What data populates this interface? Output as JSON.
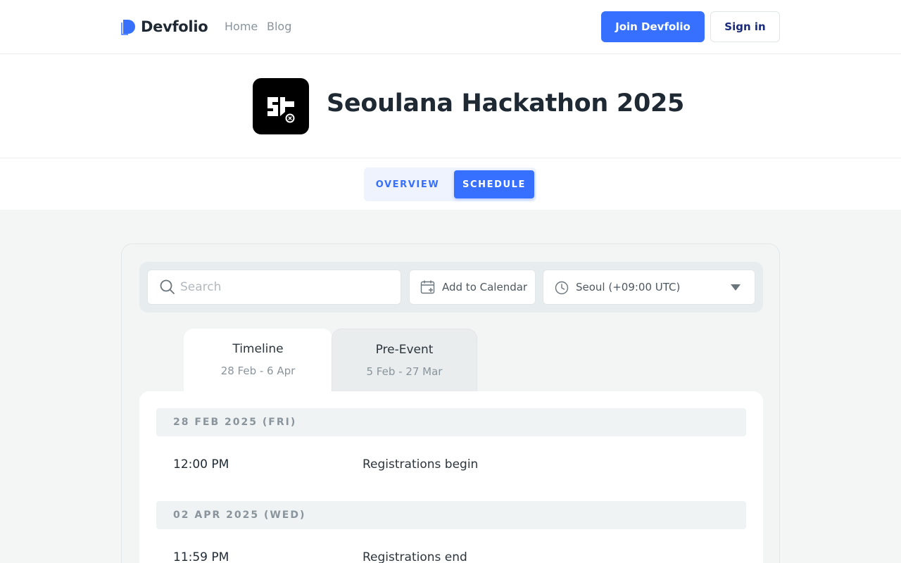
{
  "nav": {
    "brand": "Devfolio",
    "links": [
      "Home",
      "Blog"
    ],
    "join_label": "Join Devfolio",
    "signin_label": "Sign in"
  },
  "hero": {
    "title": "Seoulana Hackathon 2025",
    "logo_icon": "seoulana-logo"
  },
  "tabs": {
    "overview": "OVERVIEW",
    "schedule": "SCHEDULE",
    "active": "SCHEDULE"
  },
  "toolbar": {
    "search_placeholder": "Search",
    "search_value": "",
    "calendar_label": "Add to Calendar",
    "timezone": "Seoul (+09:00 UTC)"
  },
  "schedule_tabs": [
    {
      "title": "Timeline",
      "dates": "28 Feb - 6 Apr",
      "active": true
    },
    {
      "title": "Pre-Event",
      "dates": "5 Feb - 27 Mar",
      "active": false
    }
  ],
  "days": [
    {
      "date": "28 FEB 2025 (FRI)",
      "events": [
        {
          "time": "12:00 PM",
          "name": "Registrations begin"
        }
      ]
    },
    {
      "date": "02 APR 2025 (WED)",
      "events": [
        {
          "time": "11:59 PM",
          "name": "Registrations end"
        }
      ]
    }
  ],
  "colors": {
    "accent": "#3770ff",
    "signin_text": "#1a2a7a",
    "background": "#f4f6f5"
  }
}
